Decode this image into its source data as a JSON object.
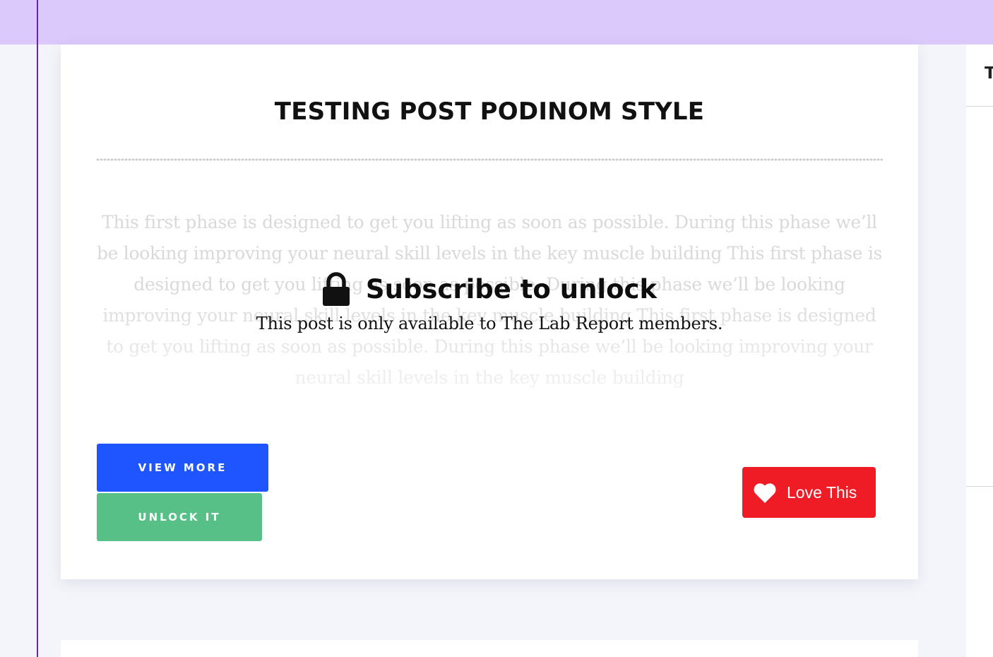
{
  "post": {
    "title": "TESTING POST PODINOM STYLE",
    "excerpt": "This first phase is designed to get you lifting as soon as possible. During this phase we’ll be looking improving your neural skill levels in the key muscle building This first phase is designed to get you lifting as soon as possible. During this phase we’ll be looking improving your neural skill levels in the key muscle building This first phase is designed to get you lifting as soon as possible. During this phase we’ll be looking improving your neural skill levels in the key muscle building"
  },
  "paywall": {
    "icon": "lock-icon",
    "heading": "Subscribe to unlock",
    "message": "This post is only available to The Lab Report members."
  },
  "buttons": {
    "view_more": "VIEW MORE",
    "unlock": "UNLOCK IT",
    "love": "Love This",
    "love_icon": "heart-icon"
  },
  "sidebar": {
    "header_initial": "T"
  },
  "colors": {
    "top_band": "#dbc9fc",
    "accent_rule": "#6a1fd6",
    "view_more": "#1e55ff",
    "unlock": "#56c086",
    "love": "#ef1b25"
  }
}
